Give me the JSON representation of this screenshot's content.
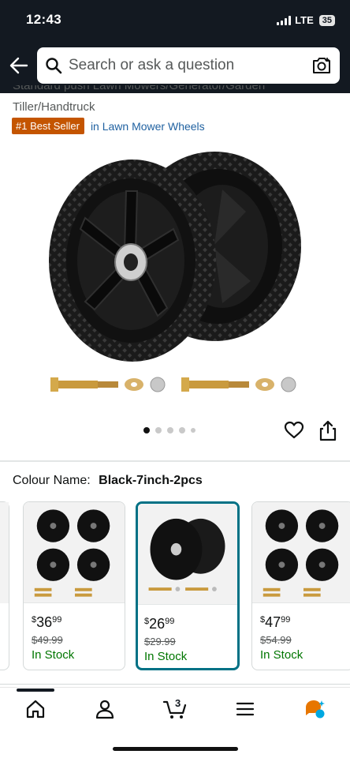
{
  "status_bar": {
    "time": "12:43",
    "network": "LTE",
    "battery": "35"
  },
  "search": {
    "placeholder": "Search or ask a question"
  },
  "product": {
    "title_line1": "Standard push Lawn Mowers/Generator/Garden",
    "title_line2": "Tiller/Handtruck",
    "best_seller_badge": "#1 Best Seller",
    "best_seller_category": "in Lawn Mower Wheels",
    "image_count": 5,
    "active_image_index": 0
  },
  "colour": {
    "label": "Colour Name:",
    "value": "Black-7inch-2pcs"
  },
  "variants": [
    {
      "currency": "$",
      "price_whole": "36",
      "price_fraction": "99",
      "list_price": "$49.99",
      "availability": "In Stock",
      "selected": false
    },
    {
      "currency": "$",
      "price_whole": "26",
      "price_fraction": "99",
      "list_price": "$29.99",
      "availability": "In Stock",
      "selected": true
    },
    {
      "currency": "$",
      "price_whole": "47",
      "price_fraction": "99",
      "list_price": "$54.99",
      "availability": "In Stock",
      "selected": false
    }
  ],
  "bottom_nav": {
    "cart_count": "3",
    "items": [
      "home-icon",
      "account-icon",
      "cart-icon",
      "menu-icon",
      "rufus-icon"
    ]
  },
  "colors": {
    "header_bg": "#131921",
    "badge": "#c45500",
    "link": "#2162a1",
    "selected_border": "#007185",
    "in_stock": "#007600"
  }
}
